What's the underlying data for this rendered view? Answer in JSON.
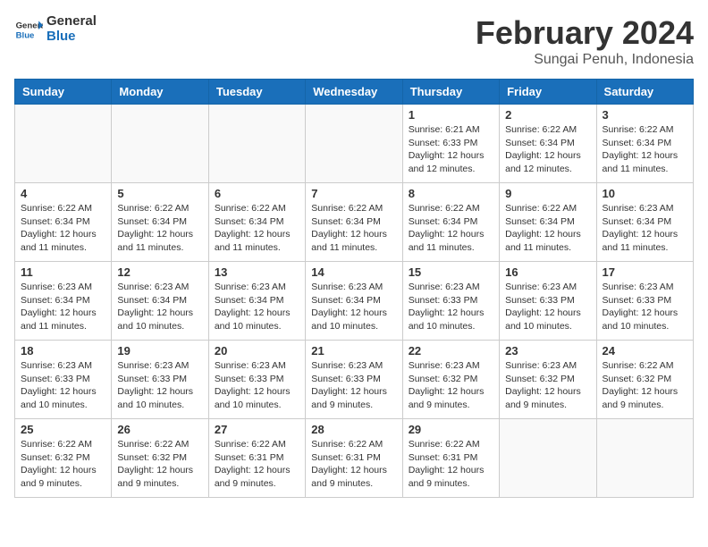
{
  "logo": {
    "text_general": "General",
    "text_blue": "Blue"
  },
  "title": "February 2024",
  "subtitle": "Sungai Penuh, Indonesia",
  "days_of_week": [
    "Sunday",
    "Monday",
    "Tuesday",
    "Wednesday",
    "Thursday",
    "Friday",
    "Saturday"
  ],
  "weeks": [
    [
      {
        "day": "",
        "info": ""
      },
      {
        "day": "",
        "info": ""
      },
      {
        "day": "",
        "info": ""
      },
      {
        "day": "",
        "info": ""
      },
      {
        "day": "1",
        "info": "Sunrise: 6:21 AM\nSunset: 6:33 PM\nDaylight: 12 hours and 12 minutes."
      },
      {
        "day": "2",
        "info": "Sunrise: 6:22 AM\nSunset: 6:34 PM\nDaylight: 12 hours and 12 minutes."
      },
      {
        "day": "3",
        "info": "Sunrise: 6:22 AM\nSunset: 6:34 PM\nDaylight: 12 hours and 11 minutes."
      }
    ],
    [
      {
        "day": "4",
        "info": "Sunrise: 6:22 AM\nSunset: 6:34 PM\nDaylight: 12 hours and 11 minutes."
      },
      {
        "day": "5",
        "info": "Sunrise: 6:22 AM\nSunset: 6:34 PM\nDaylight: 12 hours and 11 minutes."
      },
      {
        "day": "6",
        "info": "Sunrise: 6:22 AM\nSunset: 6:34 PM\nDaylight: 12 hours and 11 minutes."
      },
      {
        "day": "7",
        "info": "Sunrise: 6:22 AM\nSunset: 6:34 PM\nDaylight: 12 hours and 11 minutes."
      },
      {
        "day": "8",
        "info": "Sunrise: 6:22 AM\nSunset: 6:34 PM\nDaylight: 12 hours and 11 minutes."
      },
      {
        "day": "9",
        "info": "Sunrise: 6:22 AM\nSunset: 6:34 PM\nDaylight: 12 hours and 11 minutes."
      },
      {
        "day": "10",
        "info": "Sunrise: 6:23 AM\nSunset: 6:34 PM\nDaylight: 12 hours and 11 minutes."
      }
    ],
    [
      {
        "day": "11",
        "info": "Sunrise: 6:23 AM\nSunset: 6:34 PM\nDaylight: 12 hours and 11 minutes."
      },
      {
        "day": "12",
        "info": "Sunrise: 6:23 AM\nSunset: 6:34 PM\nDaylight: 12 hours and 10 minutes."
      },
      {
        "day": "13",
        "info": "Sunrise: 6:23 AM\nSunset: 6:34 PM\nDaylight: 12 hours and 10 minutes."
      },
      {
        "day": "14",
        "info": "Sunrise: 6:23 AM\nSunset: 6:34 PM\nDaylight: 12 hours and 10 minutes."
      },
      {
        "day": "15",
        "info": "Sunrise: 6:23 AM\nSunset: 6:33 PM\nDaylight: 12 hours and 10 minutes."
      },
      {
        "day": "16",
        "info": "Sunrise: 6:23 AM\nSunset: 6:33 PM\nDaylight: 12 hours and 10 minutes."
      },
      {
        "day": "17",
        "info": "Sunrise: 6:23 AM\nSunset: 6:33 PM\nDaylight: 12 hours and 10 minutes."
      }
    ],
    [
      {
        "day": "18",
        "info": "Sunrise: 6:23 AM\nSunset: 6:33 PM\nDaylight: 12 hours and 10 minutes."
      },
      {
        "day": "19",
        "info": "Sunrise: 6:23 AM\nSunset: 6:33 PM\nDaylight: 12 hours and 10 minutes."
      },
      {
        "day": "20",
        "info": "Sunrise: 6:23 AM\nSunset: 6:33 PM\nDaylight: 12 hours and 10 minutes."
      },
      {
        "day": "21",
        "info": "Sunrise: 6:23 AM\nSunset: 6:33 PM\nDaylight: 12 hours and 9 minutes."
      },
      {
        "day": "22",
        "info": "Sunrise: 6:23 AM\nSunset: 6:32 PM\nDaylight: 12 hours and 9 minutes."
      },
      {
        "day": "23",
        "info": "Sunrise: 6:23 AM\nSunset: 6:32 PM\nDaylight: 12 hours and 9 minutes."
      },
      {
        "day": "24",
        "info": "Sunrise: 6:22 AM\nSunset: 6:32 PM\nDaylight: 12 hours and 9 minutes."
      }
    ],
    [
      {
        "day": "25",
        "info": "Sunrise: 6:22 AM\nSunset: 6:32 PM\nDaylight: 12 hours and 9 minutes."
      },
      {
        "day": "26",
        "info": "Sunrise: 6:22 AM\nSunset: 6:32 PM\nDaylight: 12 hours and 9 minutes."
      },
      {
        "day": "27",
        "info": "Sunrise: 6:22 AM\nSunset: 6:31 PM\nDaylight: 12 hours and 9 minutes."
      },
      {
        "day": "28",
        "info": "Sunrise: 6:22 AM\nSunset: 6:31 PM\nDaylight: 12 hours and 9 minutes."
      },
      {
        "day": "29",
        "info": "Sunrise: 6:22 AM\nSunset: 6:31 PM\nDaylight: 12 hours and 9 minutes."
      },
      {
        "day": "",
        "info": ""
      },
      {
        "day": "",
        "info": ""
      }
    ]
  ]
}
